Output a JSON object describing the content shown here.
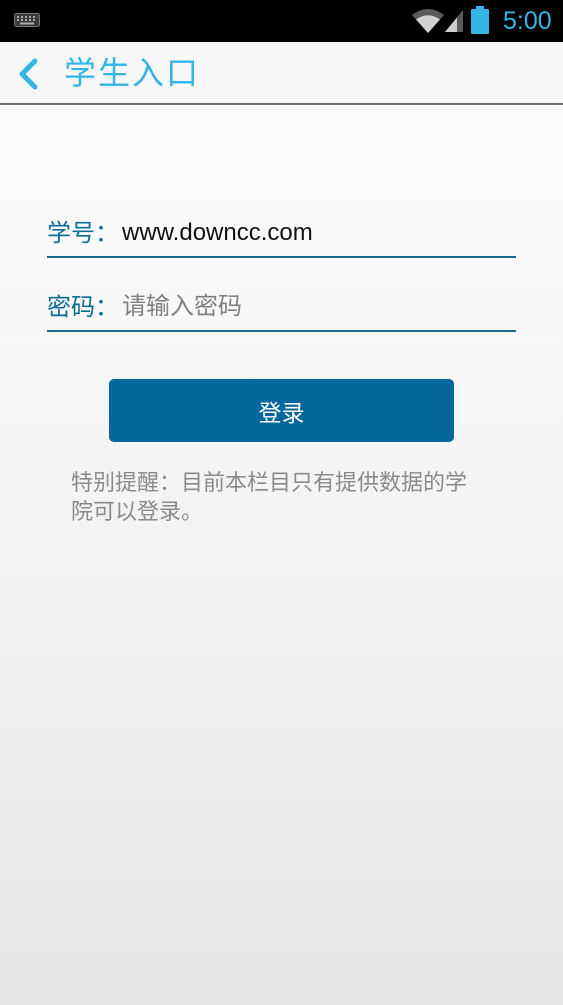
{
  "status_bar": {
    "time": "5:00",
    "icons": [
      "keyboard-icon",
      "wifi-icon",
      "signal-icon",
      "battery-icon"
    ],
    "accent_color": "#33b5e5"
  },
  "header": {
    "back_icon": "chevron-left-icon",
    "title": "学生入口"
  },
  "form": {
    "student_id": {
      "label": "学号：",
      "value": "www.downcc.com"
    },
    "password": {
      "label": "密码：",
      "placeholder": "请输入密码",
      "value": ""
    },
    "login_label": "登录"
  },
  "notice": "特别提醒：目前本栏目只有提供数据的学院可以登录。",
  "colors": {
    "primary": "#05679b",
    "label": "#0c6c96",
    "notice_text": "#8a8a8a"
  }
}
